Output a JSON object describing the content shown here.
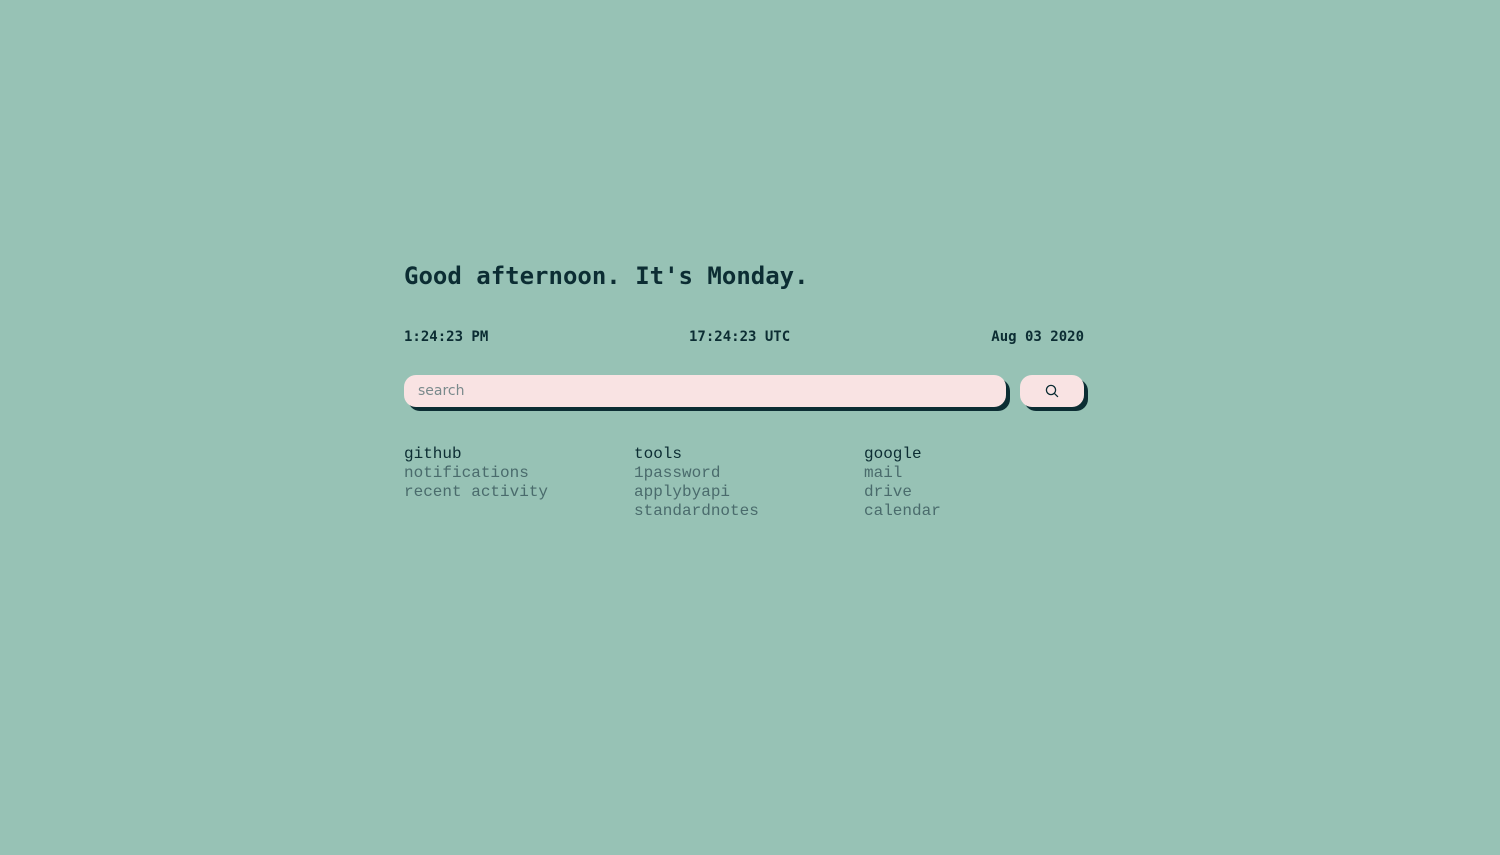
{
  "greeting": "Good afternoon. It's Monday.",
  "clock": {
    "local_time": "1:24:23 PM",
    "utc_time": "17:24:23 UTC",
    "date": "Aug 03 2020"
  },
  "search": {
    "placeholder": "search",
    "value": "",
    "button_icon": "search-icon"
  },
  "link_groups": [
    {
      "title": "github",
      "links": [
        "notifications",
        "recent activity"
      ]
    },
    {
      "title": "tools",
      "links": [
        "1password",
        "applybyapi",
        "standardnotes"
      ]
    },
    {
      "title": "google",
      "links": [
        "mail",
        "drive",
        "calendar"
      ]
    }
  ],
  "colors": {
    "background": "#97c2b5",
    "text_dark": "#0c2d33",
    "link_muted": "#4a6b6c",
    "input_bg": "#f9e3e3",
    "shadow": "#0c2d33"
  }
}
